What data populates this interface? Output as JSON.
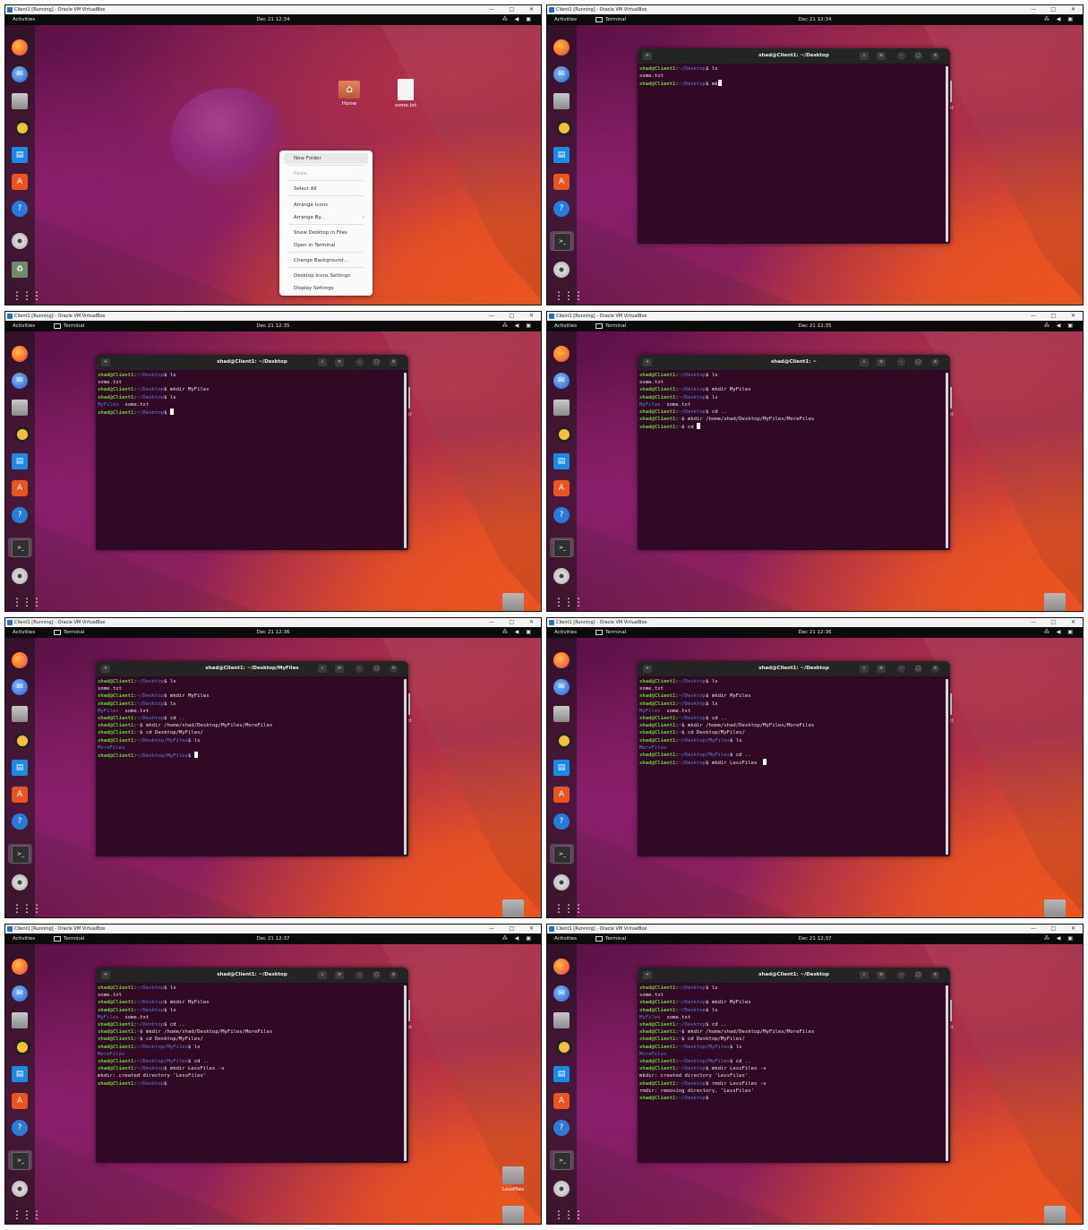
{
  "vm_title": "Client1 [Running] - Oracle VM VirtualBox",
  "win_min": "—",
  "win_max": "□",
  "win_close": "✕",
  "activities": "Activities",
  "app_name": "Terminal",
  "tray": "⁂ ◀ ▣",
  "dock_icons": [
    "firefox-icon",
    "thunderbird-icon",
    "files-icon",
    "rhythmbox-icon",
    "writer-icon",
    "software-icon",
    "help-icon",
    "terminal-icon",
    "dvd-icon",
    "trash-icon",
    "app-grid-icon"
  ],
  "desktop_labels": {
    "home": "Home",
    "some_txt": "some.txt",
    "txt_short": "txt",
    "myfiles": "MyFiles",
    "lessfiles": "LessFiles"
  },
  "context_menu": [
    {
      "label": "New Folder",
      "state": "hover"
    },
    {
      "label": "Paste",
      "state": "disabled"
    },
    {
      "label": "Select All",
      "state": "normal"
    },
    {
      "label": "Arrange Icons",
      "state": "normal"
    },
    {
      "label": "Arrange By...",
      "state": "submenu"
    },
    {
      "label": "Show Desktop in Files",
      "state": "normal"
    },
    {
      "label": "Open in Terminal",
      "state": "normal"
    },
    {
      "label": "Change Background...",
      "state": "normal"
    },
    {
      "label": "Desktop Icons Settings",
      "state": "normal"
    },
    {
      "label": "Display Settings",
      "state": "normal"
    }
  ],
  "panels": [
    {
      "time": "Dec 21  12:34",
      "show_app": false,
      "terminal": null,
      "desktop": "initial"
    },
    {
      "time": "Dec 21  12:34",
      "show_app": true,
      "terminal": {
        "title": "shad@Client1: ~/Desktop",
        "lines": [
          [
            "shad@Client1:",
            "~/Desktop",
            "$ ls"
          ],
          [
            "",
            "",
            "some.txt"
          ],
          [
            "shad@Client1:",
            "~/Desktop",
            "$ mk"
          ]
        ]
      },
      "desktop": "txt"
    },
    {
      "time": "Dec 21  12:35",
      "show_app": true,
      "terminal": {
        "title": "shad@Client1: ~/Desktop",
        "lines": [
          [
            "shad@Client1:",
            "~/Desktop",
            "$ ls"
          ],
          [
            "",
            "",
            "some.txt"
          ],
          [
            "shad@Client1:",
            "~/Desktop",
            "$ mkdir MyFiles"
          ],
          [
            "shad@Client1:",
            "~/Desktop",
            "$ ls"
          ],
          [
            "",
            "MyFiles",
            "  some.txt"
          ],
          [
            "shad@Client1:",
            "~/Desktop",
            "$ "
          ]
        ]
      },
      "desktop": "myfiles"
    },
    {
      "time": "Dec 21  12:35",
      "show_app": true,
      "terminal": {
        "title": "shad@Client1: ~",
        "lines": [
          [
            "shad@Client1:",
            "~/Desktop",
            "$ ls"
          ],
          [
            "",
            "",
            "some.txt"
          ],
          [
            "shad@Client1:",
            "~/Desktop",
            "$ mkdir MyFiles"
          ],
          [
            "shad@Client1:",
            "~/Desktop",
            "$ ls"
          ],
          [
            "",
            "MyFiles",
            "  some.txt"
          ],
          [
            "shad@Client1:",
            "~/Desktop",
            "$ cd .."
          ],
          [
            "shad@Client1:",
            "~",
            "$ mkdir /home/shad/Desktop/MyFiles/MoreFiles"
          ],
          [
            "shad@Client1:",
            "~",
            "$ cd "
          ]
        ]
      },
      "desktop": "myfiles"
    },
    {
      "time": "Dec 21  12:36",
      "show_app": true,
      "terminal": {
        "title": "shad@Client1: ~/Desktop/MyFiles",
        "lines": [
          [
            "shad@Client1:",
            "~/Desktop",
            "$ ls"
          ],
          [
            "",
            "",
            "some.txt"
          ],
          [
            "shad@Client1:",
            "~/Desktop",
            "$ mkdir MyFiles"
          ],
          [
            "shad@Client1:",
            "~/Desktop",
            "$ ls"
          ],
          [
            "",
            "MyFiles",
            "  some.txt"
          ],
          [
            "shad@Client1:",
            "~/Desktop",
            "$ cd .."
          ],
          [
            "shad@Client1:",
            "~",
            "$ mkdir /home/shad/Desktop/MyFiles/MoreFiles"
          ],
          [
            "shad@Client1:",
            "~",
            "$ cd Desktop/MyFiles/"
          ],
          [
            "shad@Client1:",
            "~/Desktop/MyFiles",
            "$ ls"
          ],
          [
            "",
            "MoreFiles",
            ""
          ],
          [
            "shad@Client1:",
            "~/Desktop/MyFiles",
            "$ "
          ]
        ]
      },
      "desktop": "myfiles_sel"
    },
    {
      "time": "Dec 21  12:36",
      "show_app": true,
      "terminal": {
        "title": "shad@Client1: ~/Desktop",
        "lines": [
          [
            "shad@Client1:",
            "~/Desktop",
            "$ ls"
          ],
          [
            "",
            "",
            "some.txt"
          ],
          [
            "shad@Client1:",
            "~/Desktop",
            "$ mkdir MyFiles"
          ],
          [
            "shad@Client1:",
            "~/Desktop",
            "$ ls"
          ],
          [
            "",
            "MyFiles",
            "  some.txt"
          ],
          [
            "shad@Client1:",
            "~/Desktop",
            "$ cd .."
          ],
          [
            "shad@Client1:",
            "~",
            "$ mkdir /home/shad/Desktop/MyFiles/MoreFiles"
          ],
          [
            "shad@Client1:",
            "~",
            "$ cd Desktop/MyFiles/"
          ],
          [
            "shad@Client1:",
            "~/Desktop/MyFiles",
            "$ ls"
          ],
          [
            "",
            "MoreFiles",
            ""
          ],
          [
            "shad@Client1:",
            "~/Desktop/MyFiles",
            "$ cd .."
          ],
          [
            "shad@Client1:",
            "~/Desktop",
            "$ mkdir LessFiles  "
          ]
        ]
      },
      "desktop": "myfiles_sel"
    },
    {
      "time": "Dec 21  12:37",
      "show_app": true,
      "terminal": {
        "title": "shad@Client1: ~/Desktop",
        "lines": [
          [
            "shad@Client1:",
            "~/Desktop",
            "$ ls"
          ],
          [
            "",
            "",
            "some.txt"
          ],
          [
            "shad@Client1:",
            "~/Desktop",
            "$ mkdir MyFiles"
          ],
          [
            "shad@Client1:",
            "~/Desktop",
            "$ ls"
          ],
          [
            "",
            "MyFiles",
            "  some.txt"
          ],
          [
            "shad@Client1:",
            "~/Desktop",
            "$ cd .."
          ],
          [
            "shad@Client1:",
            "~",
            "$ mkdir /home/shad/Desktop/MyFiles/MoreFiles"
          ],
          [
            "shad@Client1:",
            "~",
            "$ cd Desktop/MyFiles/"
          ],
          [
            "shad@Client1:",
            "~/Desktop/MyFiles",
            "$ ls"
          ],
          [
            "",
            "MoreFiles",
            ""
          ],
          [
            "shad@Client1:",
            "~/Desktop/MyFiles",
            "$ cd .."
          ],
          [
            "shad@Client1:",
            "~/Desktop",
            "$ mkdir LessFiles -v"
          ],
          [
            "",
            "",
            "mkdir: created directory 'LessFiles'"
          ],
          [
            "shad@Client1:",
            "~/Desktop",
            "$ "
          ]
        ]
      },
      "desktop": "lessfiles"
    },
    {
      "time": "Dec 21  12:37",
      "show_app": true,
      "terminal": {
        "title": "shad@Client1: ~/Desktop",
        "lines": [
          [
            "shad@Client1:",
            "~/Desktop",
            "$ ls"
          ],
          [
            "",
            "",
            "some.txt"
          ],
          [
            "shad@Client1:",
            "~/Desktop",
            "$ mkdir MyFiles"
          ],
          [
            "shad@Client1:",
            "~/Desktop",
            "$ ls"
          ],
          [
            "",
            "MyFiles",
            "  some.txt"
          ],
          [
            "shad@Client1:",
            "~/Desktop",
            "$ cd .."
          ],
          [
            "shad@Client1:",
            "~",
            "$ mkdir /home/shad/Desktop/MyFiles/MoreFiles"
          ],
          [
            "shad@Client1:",
            "~",
            "$ cd Desktop/MyFiles/"
          ],
          [
            "shad@Client1:",
            "~/Desktop/MyFiles",
            "$ ls"
          ],
          [
            "",
            "MoreFiles",
            ""
          ],
          [
            "shad@Client1:",
            "~/Desktop/MyFiles",
            "$ cd .."
          ],
          [
            "shad@Client1:",
            "~/Desktop",
            "$ mkdir LessFiles -v"
          ],
          [
            "",
            "",
            "mkdir: created directory 'LessFiles'"
          ],
          [
            "shad@Client1:",
            "~/Desktop",
            "$ rmdir LessFiles -v"
          ],
          [
            "",
            "",
            "rmdir: removing directory, 'LessFiles'"
          ],
          [
            "shad@Client1:",
            "~/Desktop",
            "$ "
          ]
        ]
      },
      "desktop": "myfiles"
    }
  ]
}
